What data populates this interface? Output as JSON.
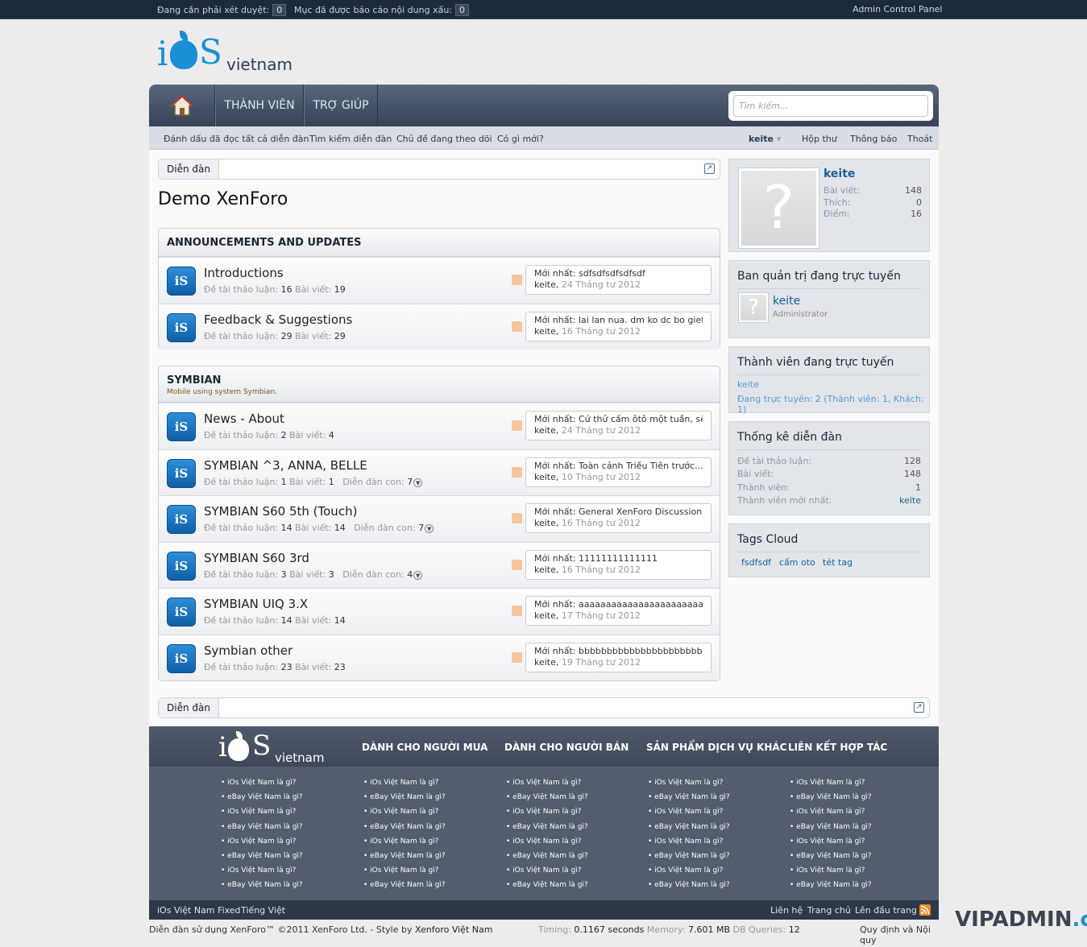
{
  "adminbar": {
    "pending_label": "Đang cần phải xét duyệt:",
    "pending_count": "0",
    "reported_label": "Mục đã được báo cáo nội dung xấu:",
    "reported_count": "0",
    "acp": "Admin Control Panel"
  },
  "logo": {
    "i": "i",
    "s": "S",
    "vietnam": "vietnam"
  },
  "nav": {
    "tabs": [
      "THÀNH VIÊN",
      "TRỢ GIÚP"
    ],
    "search_placeholder": "Tìm kiếm..."
  },
  "subnav": {
    "left": [
      "Đánh dấu đã đọc tất cả diễn đàn",
      "Tìm kiếm diễn đàn",
      "Chủ đề đang theo dõi",
      "Có gì mới?"
    ],
    "user": "keite",
    "inbox": "Hộp thư",
    "alerts": "Thông báo",
    "logout": "Thoát"
  },
  "breadcrumb": {
    "label": "Diễn đàn"
  },
  "page_title": "Demo XenForo",
  "labels": {
    "threads": "Đề tài thảo luận:",
    "posts": "Bài viết:",
    "subforums": "Diễn đàn con:",
    "latest": "Mới nhất:"
  },
  "sections": [
    {
      "title": "ANNOUNCEMENTS AND UPDATES",
      "description": "",
      "forums": [
        {
          "name": "Introductions",
          "threads": "16",
          "posts": "19",
          "subforums": "",
          "latest": "sdfsdfsdfsdfsdf",
          "user": "keite,",
          "date": "24 Tháng tư 2012"
        },
        {
          "name": "Feedback & Suggestions",
          "threads": "29",
          "posts": "29",
          "subforums": "",
          "latest": "lai lan nua. dm ko dc bo giet",
          "user": "keite,",
          "date": "16 Tháng tư 2012"
        }
      ]
    },
    {
      "title": "SYMBIAN",
      "description": "Mobile using system Symbian.",
      "forums": [
        {
          "name": "News - About",
          "threads": "2",
          "posts": "4",
          "subforums": "",
          "latest": "Cứ thử cấm ôtô một tuần, sẽ...",
          "user": "keite,",
          "date": "24 Tháng tư 2012"
        },
        {
          "name": "SYMBIAN ^3, ANNA, BELLE",
          "threads": "1",
          "posts": "1",
          "subforums": "7",
          "latest": "Toàn cảnh Triều Tiên trước...",
          "user": "keite,",
          "date": "10 Tháng tư 2012"
        },
        {
          "name": "SYMBIAN S60 5th (Touch)",
          "threads": "14",
          "posts": "14",
          "subforums": "7",
          "latest": "General XenForo Discussion...",
          "user": "keite,",
          "date": "16 Tháng tư 2012"
        },
        {
          "name": "SYMBIAN S60 3rd",
          "threads": "3",
          "posts": "3",
          "subforums": "4",
          "latest": "11111111111111",
          "user": "keite,",
          "date": "16 Tháng tư 2012"
        },
        {
          "name": "SYMBIAN UIQ 3.X",
          "threads": "14",
          "posts": "14",
          "subforums": "",
          "latest": "aaaaaaaaaaaaaaaaaaaaaaaaaaaaaaaaaa",
          "user": "keite,",
          "date": "17 Tháng tư 2012"
        },
        {
          "name": "Symbian other",
          "threads": "23",
          "posts": "23",
          "subforums": "",
          "latest": "bbbbbbbbbbbbbbbbbbbbbbbbb",
          "user": "keite,",
          "date": "19 Tháng tư 2012"
        }
      ]
    }
  ],
  "visitor": {
    "name": "keite",
    "rows": [
      {
        "label": "Bài viết:",
        "value": "148"
      },
      {
        "label": "Thích:",
        "value": "0"
      },
      {
        "label": "Điểm:",
        "value": "16"
      }
    ]
  },
  "staff": {
    "title": "Ban quản trị đang trực tuyến",
    "name": "keite",
    "role": "Administrator"
  },
  "online": {
    "title": "Thành viên đang trực tuyến",
    "user": "keite",
    "summary": "Đang trực tuyến: 2 (Thành viên: 1, Khách: 1)"
  },
  "stats": {
    "title": "Thống kê diễn đàn",
    "rows": [
      {
        "label": "Đề tài thảo luận:",
        "value": "128"
      },
      {
        "label": "Bài viết:",
        "value": "148"
      },
      {
        "label": "Thành viên:",
        "value": "1"
      },
      {
        "label": "Thành viên mới nhất:",
        "value": "keite"
      }
    ]
  },
  "tags": {
    "title": "Tags Cloud",
    "items": [
      "fsdfsdf",
      "cấm oto",
      "tét tag"
    ]
  },
  "footer": {
    "headings": [
      "DÀNH CHO NGƯỜI MUA",
      "DÀNH CHO NGƯỜI BÁN",
      "SẢN PHẨM DỊCH VỤ KHÁC",
      "LIÊN KẾT HỢP TÁC"
    ],
    "links": [
      "• iOs Việt Nam là gì?",
      "• eBay Việt Nam là gì?",
      "• iOs Việt Nam là gì?",
      "• eBay Việt Nam là gì?",
      "• iOs Việt Nam là gì?",
      "• eBay Việt Nam là gì?",
      "• iOs Việt Nam là gì?",
      "• eBay Việt Nam là gì?"
    ],
    "bar_left": [
      "iOs Việt Nam Fixed",
      "Tiếng Việt"
    ],
    "bar_right": [
      "Liên hệ",
      "Trang chủ",
      "Lên đầu trang"
    ],
    "copyright": "Diễn đàn sử dụng XenForo™ ©2011 XenForo Ltd. - Style by ",
    "style_by": "Xenforo Việt Nam",
    "timing_label": "Timing:",
    "timing_value": "0.1167 seconds",
    "memory_label": "Memory:",
    "memory_value": "7.601 MB",
    "db_label": "DB Queries:",
    "db_value": "12",
    "rules": "Quy định và Nội quy"
  },
  "watermark": {
    "main": "VIPADMIN",
    "club": ".club"
  },
  "colors": {
    "accent": "#176093",
    "navbar": "#3e4b5d",
    "brand_blue": "#1b8fd6"
  }
}
